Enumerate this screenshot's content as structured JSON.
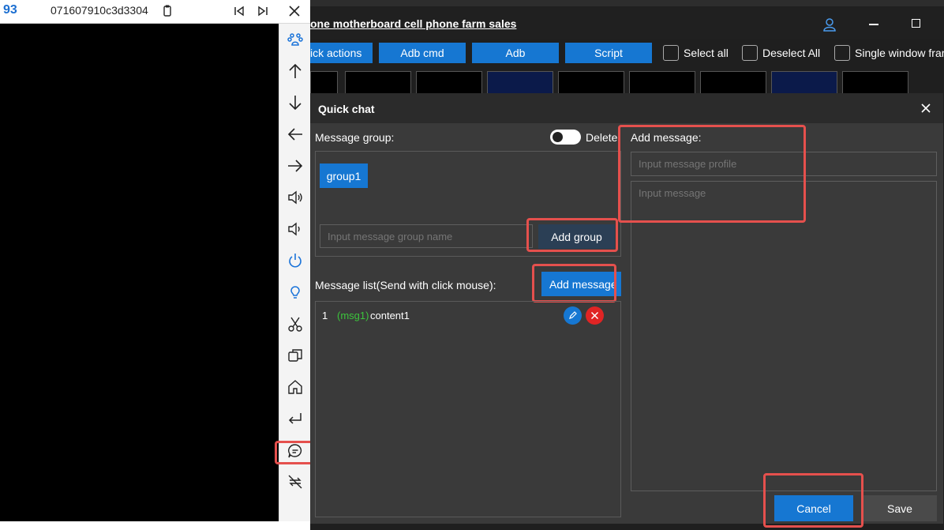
{
  "mirror": {
    "device_number": "93",
    "device_id": "071607910c3d3304"
  },
  "app": {
    "title": "one motherboard cell phone farm sales"
  },
  "toolbar": {
    "quick_actions": "ick actions",
    "adb_cmd": "Adb cmd",
    "adb": "Adb",
    "script": "Script",
    "select_all": "Select all",
    "deselect_all": "Deselect All",
    "single_window": "Single window fran"
  },
  "dialog": {
    "title": "Quick chat",
    "message_group_label": "Message group:",
    "delete_toggle_label": "Delete",
    "group_chip": "group1",
    "group_name_placeholder": "Input message group name",
    "add_group": "Add group",
    "message_list_label": "Message list(Send with click mouse):",
    "add_message_button": "Add message",
    "messages": [
      {
        "index": "1",
        "profile": "(msg1)",
        "content": "content1"
      }
    ],
    "add_message_label": "Add message:",
    "profile_placeholder": "Input message profile",
    "message_placeholder": "Input message",
    "cancel": "Cancel",
    "save": "Save"
  },
  "colors": {
    "accent": "#1677d2",
    "highlight": "#e5504d",
    "profile_green": "#3cc43c"
  }
}
